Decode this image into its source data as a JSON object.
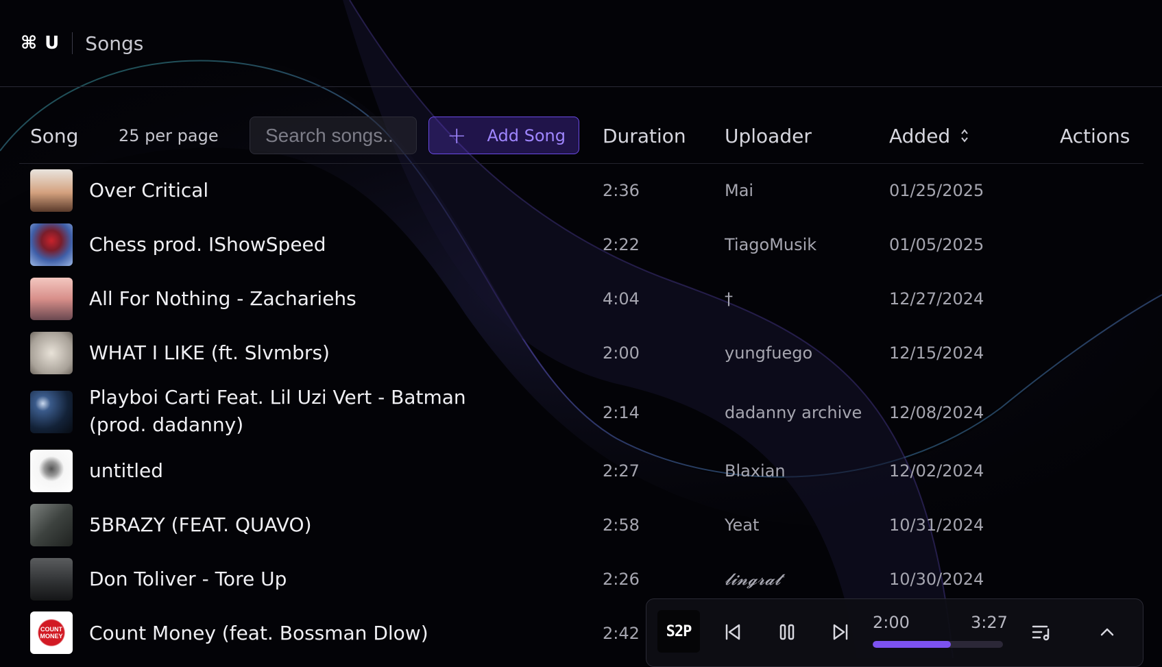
{
  "header": {
    "shortcut": "⌘ U",
    "breadcrumb": "Songs"
  },
  "table": {
    "columns": {
      "song": "Song",
      "duration": "Duration",
      "uploader": "Uploader",
      "added": "Added",
      "actions": "Actions"
    },
    "per_page": "25 per page",
    "search_placeholder": "Search songs..",
    "add_song_label": "Add Song",
    "rows": [
      {
        "title": "Over Critical",
        "duration": "2:36",
        "uploader": "Mai",
        "added": "01/25/2025",
        "cover": "sunset-figure-cover",
        "cover_color": "#c9a48a"
      },
      {
        "title": "Chess prod. IShowSpeed",
        "duration": "2:22",
        "uploader": "TiagoMusik",
        "added": "01/05/2025",
        "cover": "red-eye-cover",
        "cover_color": "#4a6ec2"
      },
      {
        "title": "All For Nothing - Zachariehs",
        "duration": "4:04",
        "uploader": "†",
        "added": "12/27/2024",
        "cover": "beach-cover",
        "cover_color": "#d7a59a"
      },
      {
        "title": "WHAT I LIKE (ft. Slvmbrs)",
        "duration": "2:00",
        "uploader": "yungfuego",
        "added": "12/15/2024",
        "cover": "sketch-face-cover",
        "cover_color": "#b9b3ab"
      },
      {
        "title": "Playboi Carti Feat. Lil Uzi Vert - Batman (prod. dadanny)",
        "duration": "2:14",
        "uploader": "dadanny archive",
        "added": "12/08/2024",
        "cover": "night-moon-cover",
        "cover_color": "#1f3354"
      },
      {
        "title": "untitled",
        "duration": "2:27",
        "uploader": "Blaxian",
        "added": "12/02/2024",
        "cover": "portrait-sketch-cover",
        "cover_color": "#f2f2f2"
      },
      {
        "title": "5BRAZY (FEAT. QUAVO)",
        "duration": "2:58",
        "uploader": "Yeat",
        "added": "10/31/2024",
        "cover": "dark-room-cover",
        "cover_color": "#4e5552"
      },
      {
        "title": "Don Toliver - Tore Up",
        "duration": "2:26",
        "uploader": "𝓵𝓲𝓷𝓰𝓻𝓪𝓽",
        "added": "10/30/2024",
        "cover": "crowd-cover",
        "cover_color": "#3b3d3f"
      },
      {
        "title": "Count Money (feat. Bossman Dlow)",
        "duration": "2:42",
        "uploader": "",
        "added": "",
        "cover": "count-money-cover",
        "cover_color": "#c9141f",
        "cover_text": "COUNT MONEY"
      }
    ]
  },
  "player": {
    "logo_text": "S2P",
    "elapsed": "2:00",
    "total": "3:27",
    "progress": 0.6
  },
  "colors": {
    "accent": "#7c52f0",
    "background": "#030307"
  }
}
